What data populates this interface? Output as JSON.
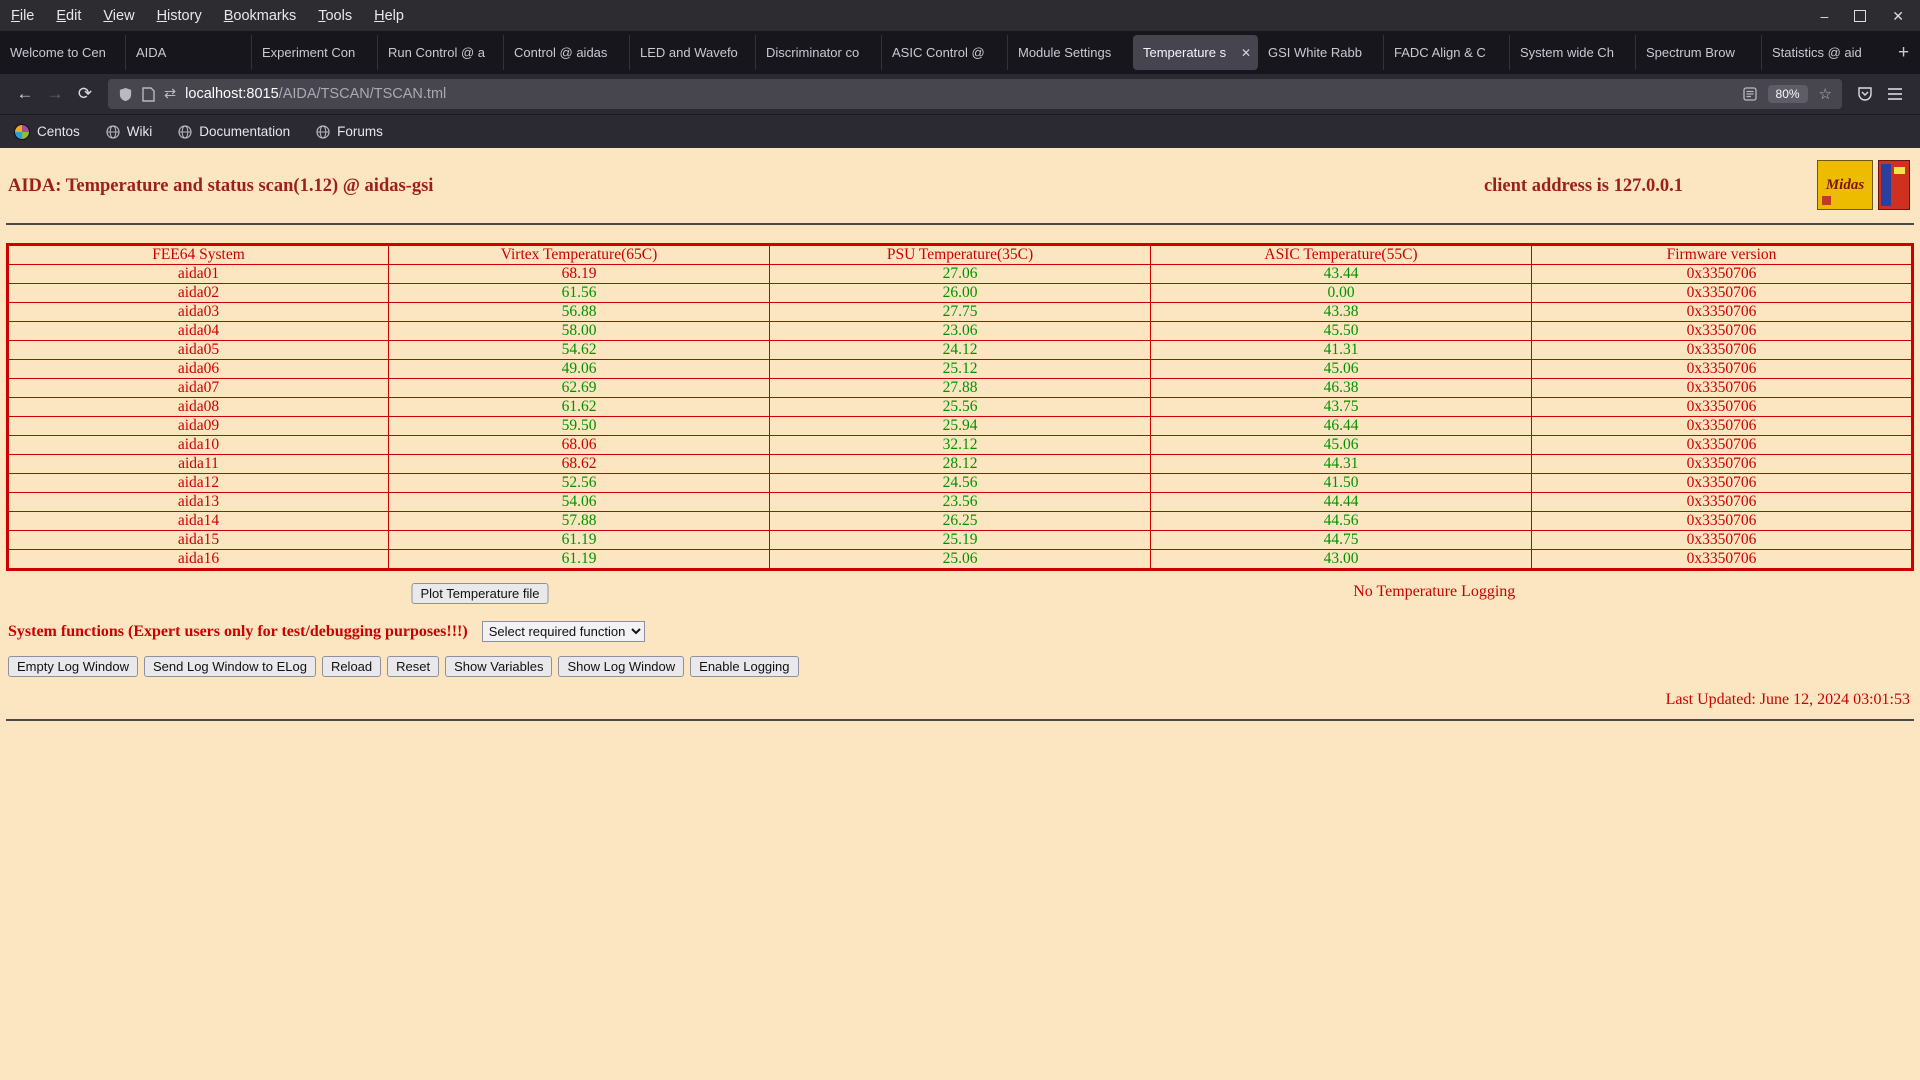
{
  "browser": {
    "menubar": {
      "items": [
        "File",
        "Edit",
        "View",
        "History",
        "Bookmarks",
        "Tools",
        "Help"
      ]
    },
    "window_controls": {
      "minimize": "–",
      "close": "✕"
    },
    "tabs": [
      {
        "label": "Welcome to Cen",
        "active": false
      },
      {
        "label": "AIDA",
        "active": false
      },
      {
        "label": "Experiment Con",
        "active": false
      },
      {
        "label": "Run Control @ a",
        "active": false
      },
      {
        "label": "Control @ aidas",
        "active": false
      },
      {
        "label": "LED and Wavefo",
        "active": false
      },
      {
        "label": "Discriminator co",
        "active": false
      },
      {
        "label": "ASIC Control @",
        "active": false
      },
      {
        "label": "Module Settings",
        "active": false
      },
      {
        "label": "Temperature s",
        "active": true
      },
      {
        "label": "GSI White Rabb",
        "active": false
      },
      {
        "label": "FADC Align & C",
        "active": false
      },
      {
        "label": "System wide Ch",
        "active": false
      },
      {
        "label": "Spectrum Brow",
        "active": false
      },
      {
        "label": "Statistics @ aid",
        "active": false
      }
    ],
    "new_tab_label": "+",
    "tab_close_label": "✕",
    "nav": {
      "back": "←",
      "forward": "→",
      "reload": "⟳"
    },
    "urlbar": {
      "host": "localhost:8015",
      "path": "/AIDA/TSCAN/TSCAN.tml",
      "zoom": "80%",
      "star": "☆",
      "swap_icon": "⇄"
    },
    "bookmarks": [
      {
        "label": "Centos",
        "icon": "centos"
      },
      {
        "label": "Wiki",
        "icon": "globe"
      },
      {
        "label": "Documentation",
        "icon": "globe"
      },
      {
        "label": "Forums",
        "icon": "globe"
      }
    ]
  },
  "page": {
    "title": "AIDA: Temperature and status scan(1.12) @ aidas-gsi",
    "client_address": "client address is 127.0.0.1",
    "logos": {
      "midas_label": "Midas"
    },
    "table": {
      "headers": [
        "FEE64 System",
        "Virtex Temperature(65C)",
        "PSU Temperature(35C)",
        "ASIC Temperature(55C)",
        "Firmware version"
      ],
      "thresholds": {
        "virtex": 65,
        "psu": 35,
        "asic": 55
      },
      "rows": [
        {
          "system": "aida01",
          "virtex": "68.19",
          "psu": "27.06",
          "asic": "43.44",
          "firmware": "0x3350706"
        },
        {
          "system": "aida02",
          "virtex": "61.56",
          "psu": "26.00",
          "asic": "0.00",
          "firmware": "0x3350706"
        },
        {
          "system": "aida03",
          "virtex": "56.88",
          "psu": "27.75",
          "asic": "43.38",
          "firmware": "0x3350706"
        },
        {
          "system": "aida04",
          "virtex": "58.00",
          "psu": "23.06",
          "asic": "45.50",
          "firmware": "0x3350706"
        },
        {
          "system": "aida05",
          "virtex": "54.62",
          "psu": "24.12",
          "asic": "41.31",
          "firmware": "0x3350706"
        },
        {
          "system": "aida06",
          "virtex": "49.06",
          "psu": "25.12",
          "asic": "45.06",
          "firmware": "0x3350706"
        },
        {
          "system": "aida07",
          "virtex": "62.69",
          "psu": "27.88",
          "asic": "46.38",
          "firmware": "0x3350706"
        },
        {
          "system": "aida08",
          "virtex": "61.62",
          "psu": "25.56",
          "asic": "43.75",
          "firmware": "0x3350706"
        },
        {
          "system": "aida09",
          "virtex": "59.50",
          "psu": "25.94",
          "asic": "46.44",
          "firmware": "0x3350706"
        },
        {
          "system": "aida10",
          "virtex": "68.06",
          "psu": "32.12",
          "asic": "45.06",
          "firmware": "0x3350706"
        },
        {
          "system": "aida11",
          "virtex": "68.62",
          "psu": "28.12",
          "asic": "44.31",
          "firmware": "0x3350706"
        },
        {
          "system": "aida12",
          "virtex": "52.56",
          "psu": "24.56",
          "asic": "41.50",
          "firmware": "0x3350706"
        },
        {
          "system": "aida13",
          "virtex": "54.06",
          "psu": "23.56",
          "asic": "44.44",
          "firmware": "0x3350706"
        },
        {
          "system": "aida14",
          "virtex": "57.88",
          "psu": "26.25",
          "asic": "44.56",
          "firmware": "0x3350706"
        },
        {
          "system": "aida15",
          "virtex": "61.19",
          "psu": "25.19",
          "asic": "44.75",
          "firmware": "0x3350706"
        },
        {
          "system": "aida16",
          "virtex": "61.19",
          "psu": "25.06",
          "asic": "43.00",
          "firmware": "0x3350706"
        }
      ]
    },
    "plot_button": "Plot Temperature file",
    "logging_status": "No Temperature Logging",
    "system_functions_label": "System functions (Expert users only for test/debugging purposes!!!)",
    "function_select_value": "Select required function",
    "action_buttons": [
      "Empty Log Window",
      "Send Log Window to ELog",
      "Reload",
      "Reset",
      "Show Variables",
      "Show Log Window",
      "Enable Logging"
    ],
    "last_updated": "Last Updated: June 12, 2024 03:01:53"
  },
  "colors": {
    "page_bg": "#fce6c2",
    "table_border_red": "#cc0000",
    "value_ok_green": "#009300",
    "value_alarm_red": "#cc0000",
    "title_red": "#9e1f1a"
  }
}
